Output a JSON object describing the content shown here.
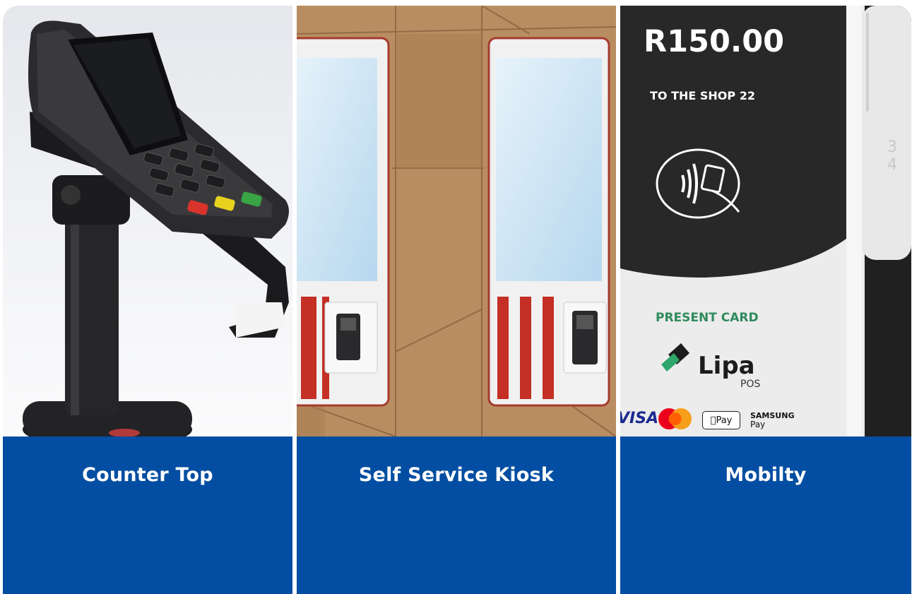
{
  "colors": {
    "panel_blue": "#034ea2",
    "title_text": "#ffffff"
  },
  "cards": [
    {
      "title": "Counter Top",
      "image": "pos-terminal-on-stand"
    },
    {
      "title": "Self Service Kiosk",
      "image": "self-service-kiosks"
    },
    {
      "title": "Mobilty",
      "image": "mobile-payment-screen",
      "screen": {
        "amount": "R150.00",
        "merchant": "TO THE SHOP 22",
        "prompt": "PRESENT CARD",
        "brand": "Lipa",
        "brand_sub": "POS",
        "visa": "VISA",
        "apple_pay": "Pay",
        "samsung_line1": "SAMSUNG",
        "samsung_line2": "Pay",
        "partial_text": "3 4"
      }
    }
  ]
}
